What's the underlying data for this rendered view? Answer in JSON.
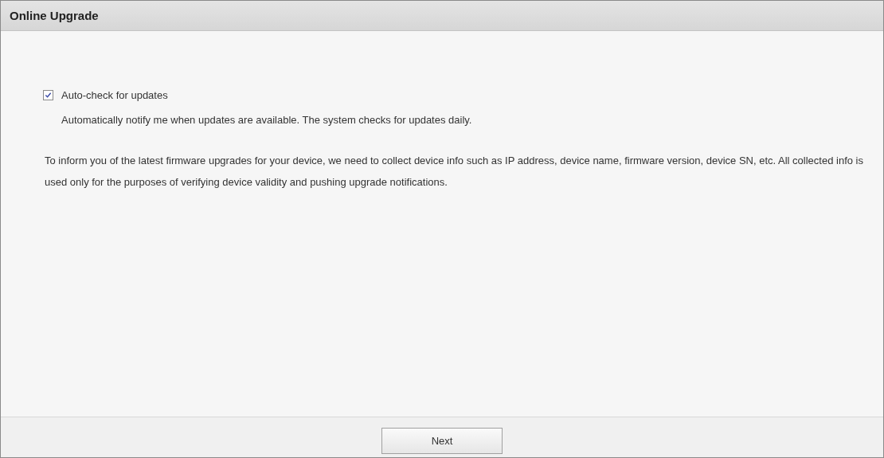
{
  "panel": {
    "title": "Online Upgrade"
  },
  "auto_check": {
    "label": "Auto-check for updates",
    "checked": true
  },
  "description": "Automatically notify me when updates are available. The system checks for updates daily.",
  "notice": "To inform you of the latest firmware upgrades for your device, we need to collect device info such as IP address, device name, firmware version, device SN, etc. All collected info is used only for the purposes of verifying device validity and pushing upgrade notifications.",
  "buttons": [
    "Next"
  ]
}
